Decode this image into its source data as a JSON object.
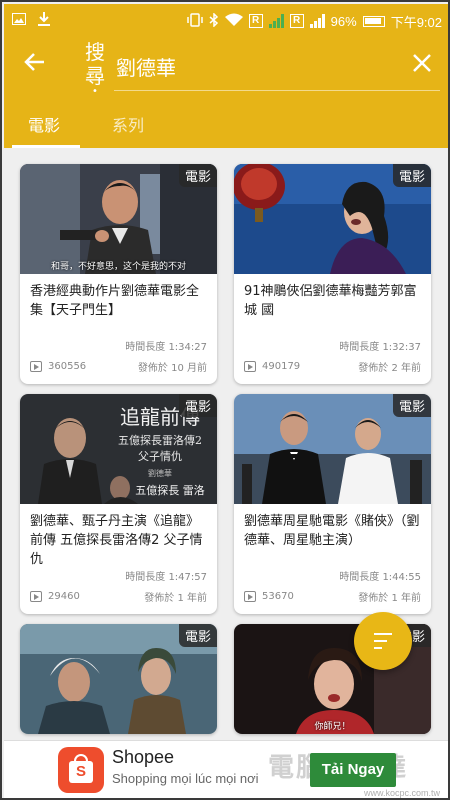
{
  "status_bar": {
    "time": "下午9:02",
    "battery": "96%",
    "sim_label": "R"
  },
  "header": {
    "search_label": "搜尋",
    "search_value": "劉德華",
    "tabs": [
      {
        "label": "電影",
        "active": true
      },
      {
        "label": "系列",
        "active": false
      }
    ]
  },
  "videos": [
    {
      "badge": "電影",
      "subtitle": "和哥，不好意思，这个是我的不对",
      "title": "香港經典動作片劉德華電影全集【天子門生】",
      "duration": "時間長度 1:34:27",
      "views": "360556",
      "posted": "發佈於 10 月前"
    },
    {
      "badge": "電影",
      "subtitle": "",
      "title": "91神鵰俠侶劉德華梅豔芳郭富城 國",
      "duration": "時間長度 1:32:37",
      "views": "490179",
      "posted": "發佈於 2 年前"
    },
    {
      "badge": "電影",
      "subtitle": "",
      "poster_text": {
        "title": "追龍前傳",
        "line2": "五億探長雷洛傳2",
        "line3": "父子情仇",
        "line4": "劉德華",
        "line5": "五億探長 雷洛"
      },
      "title": "劉德華、甄子丹主演《追龍》前傳 五億探長雷洛傳2 父子情仇",
      "duration": "時間長度 1:47:57",
      "views": "29460",
      "posted": "發佈於 1 年前"
    },
    {
      "badge": "電影",
      "subtitle": "",
      "title": "劉德華周星馳電影《賭俠》（劉德華、周星馳主演）",
      "duration": "時間長度 1:44:55",
      "views": "53670",
      "posted": "發佈於 1 年前"
    },
    {
      "badge": "電影",
      "subtitle": ""
    },
    {
      "badge": "電影",
      "subtitle": "你師兄！"
    }
  ],
  "ad": {
    "name": "Shopee",
    "tagline": "Shopping mọi lúc mọi nơi",
    "cta": "Tải Ngay",
    "logo_letter": "S"
  },
  "watermark": {
    "text": "電腦王阿達",
    "url": "www.kocpc.com.tw"
  }
}
